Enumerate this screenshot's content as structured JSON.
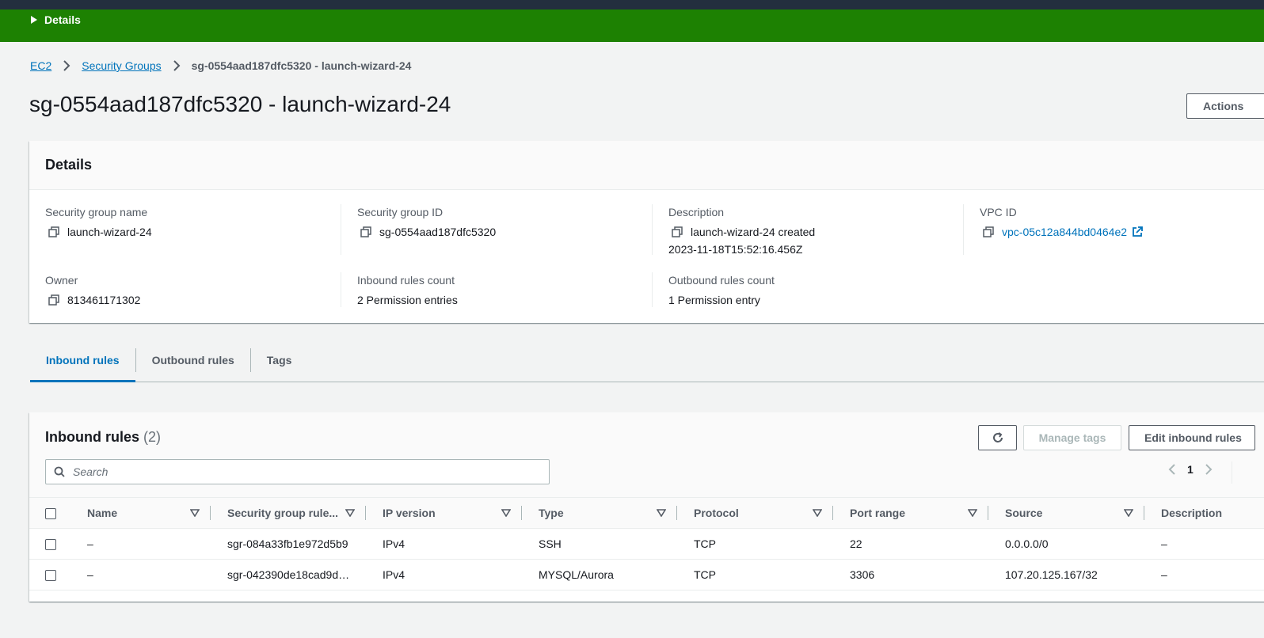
{
  "flash": {
    "toggle_label": "Details"
  },
  "breadcrumb": {
    "items": [
      "EC2",
      "Security Groups"
    ],
    "current": "sg-0554aad187dfc5320 - launch-wizard-24"
  },
  "page": {
    "title": "sg-0554aad187dfc5320 - launch-wizard-24",
    "actions_label": "Actions"
  },
  "details": {
    "title": "Details",
    "sg_name_label": "Security group name",
    "sg_name_value": "launch-wizard-24",
    "sg_id_label": "Security group ID",
    "sg_id_value": "sg-0554aad187dfc5320",
    "description_label": "Description",
    "description_line1": "launch-wizard-24 created",
    "description_line2": "2023-11-18T15:52:16.456Z",
    "vpc_label": "VPC ID",
    "vpc_value": "vpc-05c12a844bd0464e2",
    "owner_label": "Owner",
    "owner_value": "813461171302",
    "inbound_count_label": "Inbound rules count",
    "inbound_count_value": "2 Permission entries",
    "outbound_count_label": "Outbound rules count",
    "outbound_count_value": "1 Permission entry"
  },
  "tabs": [
    "Inbound rules",
    "Outbound rules",
    "Tags"
  ],
  "rules": {
    "title": "Inbound rules",
    "count": "(2)",
    "manage_tags_label": "Manage tags",
    "edit_label": "Edit inbound rules",
    "search_placeholder": "Search",
    "page_number": "1",
    "columns": [
      "Name",
      "Security group rule...",
      "IP version",
      "Type",
      "Protocol",
      "Port range",
      "Source",
      "Description"
    ],
    "rows": [
      [
        "–",
        "sgr-084a33fb1e972d5b9",
        "IPv4",
        "SSH",
        "TCP",
        "22",
        "0.0.0.0/0",
        "–"
      ],
      [
        "–",
        "sgr-042390de18cad9d…",
        "IPv4",
        "MYSQL/Aurora",
        "TCP",
        "3306",
        "107.20.125.167/32",
        "–"
      ]
    ]
  },
  "colors": {
    "accent": "#0073bb",
    "flash_green": "#1d8102",
    "topbar": "#232f3e"
  }
}
